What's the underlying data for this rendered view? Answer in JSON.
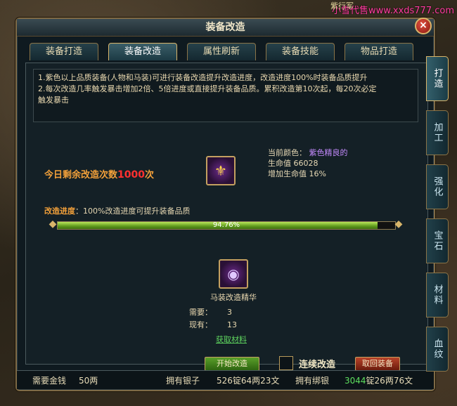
{
  "watermark": "小雪代售www.xxds777.com",
  "scene_tag": "紫行军",
  "window": {
    "title": "装备改造",
    "close_glyph": "×"
  },
  "tabs": [
    {
      "label": "装备打造"
    },
    {
      "label": "装备改造"
    },
    {
      "label": "属性刷新"
    },
    {
      "label": "装备技能"
    },
    {
      "label": "物品打造"
    }
  ],
  "side_tabs": [
    {
      "label": "打造"
    },
    {
      "label": "加工"
    },
    {
      "label": "强化"
    },
    {
      "label": "宝石"
    },
    {
      "label": "材料"
    },
    {
      "label": "血纹"
    }
  ],
  "description": {
    "line1": "1.紫色以上品质装备(人物和马装)可进行装备改造提升改造进度，改造进度100%时装备品质提升",
    "line2": "2.每次改造几率触发暴击增加2倍、5倍进度或直接提升装备品质。累积改造第10次起，每20次必定",
    "line3": "触发暴击"
  },
  "remaining": {
    "prefix": "今日剩余改造次数",
    "number": "1000",
    "suffix": "次"
  },
  "item": {
    "icon": "horse-armor-icon",
    "color_label": "当前颜色：",
    "color_value": "紫色精良的",
    "hp_label": "生命值",
    "hp_value": "66028",
    "hp_bonus_label": "增加生命值",
    "hp_bonus_value": "16%"
  },
  "progress": {
    "label": "改造进度",
    "hint": "：100%改造进度可提升装备品质",
    "percent": 94.76,
    "text": "94.76%"
  },
  "material": {
    "name": "马装改造精华",
    "need_label": "需要：",
    "need_value": "3",
    "have_label": "现有：",
    "have_value": "13",
    "get_link": "获取材料"
  },
  "buttons": {
    "start": "开始改造",
    "continuous": "连续改造",
    "retrieve": "取回装备"
  },
  "footer": {
    "gold_label": "需要金钱",
    "gold_value": "50两",
    "silver_label": "拥有银子",
    "silver_value": "526锭64两23文",
    "bound_label": "拥有绑银",
    "bound_value_hl": "3044",
    "bound_value_rest": "锭26两76文"
  },
  "colors": {
    "accent": "#d9b56a",
    "progress": "#8ccf3a",
    "remaining_number": "#ff3030",
    "purple": "#c58bff"
  }
}
